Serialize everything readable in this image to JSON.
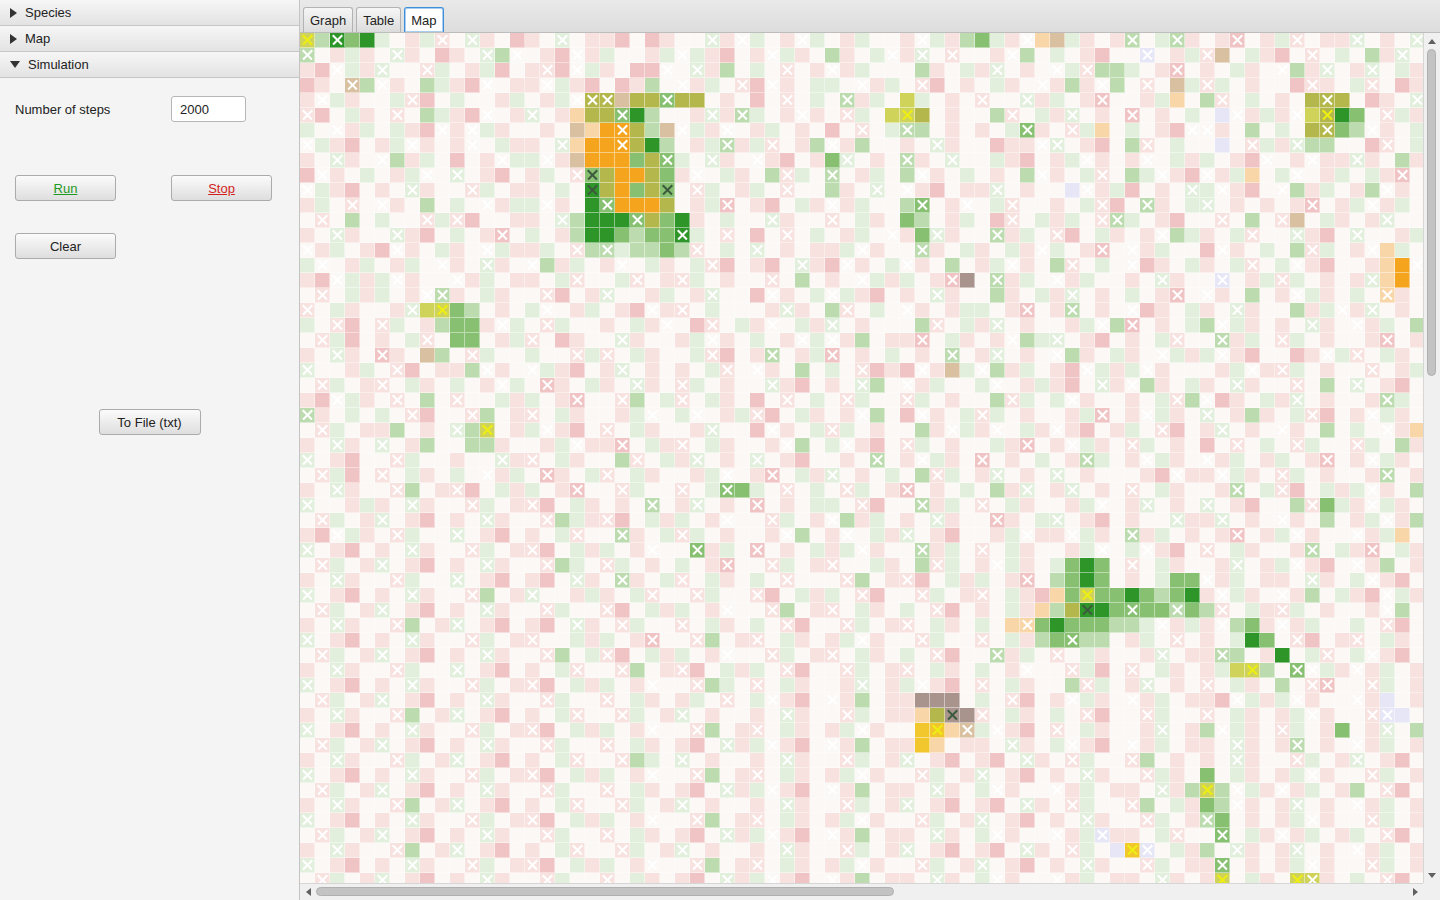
{
  "accordion": [
    {
      "label": "Species",
      "expanded": false
    },
    {
      "label": "Map",
      "expanded": false
    },
    {
      "label": "Simulation",
      "expanded": true
    }
  ],
  "simulation": {
    "steps_label": "Number of steps",
    "steps_value": "2000",
    "buttons": [
      {
        "label": "Run",
        "color": "#1e9a1e",
        "underline": true
      },
      {
        "label": "Stop",
        "color": "#d41f1f",
        "underline": true
      }
    ],
    "clear_label": "Clear",
    "export_label": "To File (txt)"
  },
  "tabs": [
    {
      "label": "Graph",
      "selected": false
    },
    {
      "label": "Table",
      "selected": false
    },
    {
      "label": "Map",
      "selected": true
    }
  ],
  "scrollbars": {
    "vertical": {
      "thumb_start": 0.0,
      "thumb_size": 0.4
    },
    "horizontal": {
      "thumb_start": 0.0,
      "thumb_size": 0.53
    }
  },
  "map": {
    "palette": {
      ".": "#fbf8f6",
      "p": "#f8e2e0",
      "r": "#f0c4c4",
      "g": "#e2efdc",
      "G": "#bcdcb0",
      "m": "#86c070",
      "d": "#2e9628",
      "o": "#f5a41e",
      "O": "#f9d6a8",
      "l": "#b4b84c",
      "y": "#cfd35a",
      "Y": "#f2c72e",
      "b": "#d8c0a0",
      "v": "#e6e6f6",
      "k": "#a8948c"
    },
    "mark_colors": {
      "w": "#ffffff",
      "y": "#eeee10",
      "d": "#3e5a3e"
    },
    "cells": [
      "yGdmd g.pgp .gp.r p.g.p pr.rp ..gp. g.p.g .pg.. p.gpG mgp.O bgp.p G.gGp .pr.p gp.pp g.p.g",
      "G.pgp .gp.r p.gG. .pr.p g..pg .gpr. p.gp. Gp.g. pg.p. .p.G. g.pr. .v.pg pb.gp r.p.g .Gpg.",
      "pr.gp g..pg .pgr. ppr.g p.rr. .gpG. g.p.p .pg.. .Gp.g pg.p. .gpGG g.pr. p.gp. .Gpg. pg.gp",
      "rp.bG .p.Gg pr..p p.gpr .rpG. .pg.p r.p.g g..pg .pr.p .gp.. pGp.G .p.bg pg.p. .rpp. gp.rp",
      "p.gp. .gpr. g..pg .pg.l lbllm ll.p. r.p.g .Gpg. yg.p. p..gp g.pr. .pgO. Gp.g. p.lll .rp.g",
      "pr.gp .p.Gg pr..p g.pOl lmdG. .pgpG g.p.p .pg.y yl.p. .Gp.g pg.p. r.p.g .v.pg p.yld m.pgp",
      "g..pg .gpr. p.gp. .p.bO oolGb .gp.. pg.p. r.p.g GG.p. p.gmp .pgO. g.pr. .p.G. g.llm G.p.g",
      ".gpr. pg.p. p..gp p.gOo ooldG .pgGp gp.pG .pG.. p.gp. .rpp. g.pr. Gp.g. .v.pg pgGG. .rp.g",
      "p.gp. .Gpg. r.p.g g.pbo oomlm g.gp. .pr.p mg.p. Gp.g. .gpr. pg.p. p..gp g.pr. .p.pp gp.Gp",
      "r.p.g .pg.. g.pr. pg.pm loolm p..gp .Gpg. G.pg. G.p.g .p.G. p.gp. Gg.pr .pgO. g..pg .gpr.",
      ".gpr. p.gp. .pg.p p.g.d lomlm .pg.p g.p.. Gp.g. .pr.p pg.p. .v.pg r.p.g g.pr. .Gpg. pG.p.",
      "pg.p. .p.G. g..pg g.p.d moool .pgr. pr.gp .pg.. Gm.p. .gp.. p.gpr .Gp.g g.p.p .pr.p g.pg.",
      ".p.G. g..pg pr..p p.gGd ddmlm dp.g. .gp.. p.gp. mG.pg .rp.g pg.pG g.pr. .p.G. pb.gp .pg..",
      "p.gp. .gpr. g.pr. g.pGd dmGmm dg.p. r.p.g .pg.. pmgp. .Gpg. pr.gp .p.Gg p.gp. .gpr. g..pg",
      ".pg.p r.p.g p..gp pg.pG GgGGm Gp.g. g.p.p pg.p. .Gp.g p.gp. g.pr. .pg.. r.p.g .Gpg. p.Og.",
      "g..pg .pg.. p.gp. .Gpg. p..gp .gpr. pr.gp r.p.g .p.G. pg.p. Gp.g. .rp.g p.gp. g.pr. .pOo.",
      "pr.gp g.p.. .pg.p p.gp. .gp.p pg.p. .p.G. p..gp g.prk .Gpg. .pg.. p.gp. .v.pg pg.p. pgOo.",
      ".p.gp g.p.G p.gp. .pr.p g..pg .pg.. r.p.g .gpr. p.gp. .Gp.g pg.p. g.pr. .p.G. p.gp. g.Op.",
      "p.gp. .pgyy mG.p. g..pg .pr.p p.g.. .pgp. Gp.g. .p.pg g.pr. pG.p. .rp.g p.gp. .Gpg. pg.p.",
      "g.pr. pg.pG mmp.g .pg.. p.gp. .rp.g p..gp g.p.. .Gp.g pg.p. .pg.G r.p.g G.gp. p.gp. .pg.G",
      ".pgr. p.gp. mm.pg p.rp. .gp.. pg.p. g.p.g .pG.p pr.gp .p.Gg g.pr. p.gp. .Gpg. pg.p. .pr.p",
      "p.gp. rp.bG .pg.. g..pg p.gp. .gpr. pG.pg r.p.g .p.G. pg.p. .Gp.g p..gp g.pr. .rp.g p.gp.",
      "g..pg .pr.p pG.p. .gpr. pg.p. p.gp. .p.G. g.prp r.pbg .Gpg. pr.gp g.p.. .pg.p pg.p. .p.pg",
      ".pg.p p.gp. g.p.g .rp.g p.gp. pg.p. .gpr. p.gG. .pg.. g..pg pr.gp .Gp.g p.gp. .p.G. g.pr.",
      "pr.gp .p.G. p..gp g.pr. .pG.g p.gp. r.p.g .pg.. pg.p. .Gpg. g.p.. p.gpG .rp.g pg.p. .pGg.",
      "Gp.g. g.pr. .pG.p p.gp. .pg.. g..pg pr.gp .p.G. r.p.g pg.p. .pgr. p.gp. g.pGp .gpr. p.gp.",
      ".pg.p pG.p. gGy.p g.pr. p.gp. .pg.. r.p.g pg.p. .Gp.g p..gp .pr.p g.pr. pg.p. .p.G. g..pO",
      "p.gp. g.pG. .GGp. .pg.p pr.gp p.gp. .p.G. g.pr. pg.p. .gpr. p.gp. pg.p. r.p.g .pg.. pg.Gp",
      "g.pr. .pg.. p..gp p.gp. .Gp.g pg.p. g.pr. .p.G. p.gp. r.p.g .pGg. p.gp. .pg.p g.pr. p.gp.",
      ".pgr. p.gp. g..pg .rp.g p.gp. .pg.. pr.gp g.p.g .Gpg. pg.p. g.p.. .pr.p p.gp. pg.p. .pG.p",
      "p.gp. .pG.p pr.gp g.pr. .pg.. p.gmm g.p.g .pg.p r.p.g .Gpg. pg.p. p.gp. .pG.g pr.gp g.p.G",
      "g..pg p.gp. .pg.p pr.gp .p.G. pg.p. r.p.g g.pr. .Gpg. p.gp. .pg.. pg.p. g.pr. .Gpmg p.gp.",
      ".pg.p g.pr. p.gp. .pGgp pr.gp g.p.. .pg.p .Gpg. p.gp. .rp.g g.pr. p..gp pg.p. .p.G. pg.pG",
      "pr.gp .pg.. g.pr. p.gp. .Gp.g pg.p. .p.G. p..gp g.pr. .pg.p p.gp. Gpg.p .pr.p g.p.. .pgO.",
      "g.pr. p.gp. .pg.p pr.gp g.p.. .mpg. r.p.g pg.p. .Gpg. p.gp. .pg.. g.pr. p.gp. .pG.g pr.gp",
      ".pg.p g.pr. p.gp. .pGg. pg.p. g.pr. .pg.p p..gp .Gpg. p.gp. gmdm. p.gp. .pg.p g.pr. .pG.p",
      "p.gp. .pg.. g.pr. pr.gp .Gp.g p.gp. g.p.. .pG.p pr.gp g.pr. Gmdm. p.gmm .pg.p p.gp. g.pr.",
      "g.pr. p.gp. .pG.p g..pg p.gp. .pg.. pr.gp g.pr. .pg.p p.gpr Omymm dmGmd p.gp. .pG.g pr.gp",
      ".pg.p g.pr. p.gp. .pg.. pr.gp g.p.. .pG.p p.gp. g.pr. p.gpO Glddm mmmGm Gp.gp pg.p. .p.G.",
      "p.gp. .pG.p g.pr. pr.gp .pg.. p.gp. g.pr. .pg.p p.gp. g.OOm dmmmG Gg.pg p.Gmp .pg.. g.pr.",
      "g.pr. p.gp. .pg.p p..gp g.pr. .pG.p p.gp. pg.p. .pg.. p.gpG mmGG. pg.p. p.gdm .pr.p p.gp.",
      ".pg.p g.pr. p.gp. .pG.g pr.gp g.p.. .pg.p p.gp. g.pr. .Gpg. p.gp. .pg.p pGG.p d.gp. g.pr.",
      "p.gp. .pg.. g.pr. p.gp. .pG.p pr.gp g.pr. .pg.p p.gp. g.p.. .pgr. p.gp. pgyyG .m.gp .pg.p",
      "g.pr. p.gp. .pg.p pr.gp g.p.. .pGg. p.gp. .pg.p g.pr. p.gp. .Gpg. pg.p. p.gp. G.pr. .pg.p",
      ".pg.p g.pr. p.gp. .pg.. p.gp. pg.p. g.pr. .pG.p pkkk. g.pr. p.gp. .pg.p pr.gp g.p.. .pv.p",
      "p.gp. .pG.p g.pr. p.gp. .pg.p g.p.. p.gp. .pg.p pOlkk p.gp. g.pr. .pg.. p.gp. pg.p. .pvv.",
      "g.pr. p.gp. .pg.p pr.gp g.p.. .pG.p p.gp. pg.p. .YYOb g.pr. p.gp. .pg.p G.gp. pg.pm .pg.G",
      ".pg.p g.pr. p.gp. .pg.. p.gp. pr.gp g.pr. .pG.p pYO.p p.gp. g.pr. .pg.p p.gp. pG.p. .pg.p",
      "p.gp. .pg.p g.pr. p.gp. .pGg. g.p.. p.gp. .pg.p g.pr. pr.gp .pg.. pG.p. p.gp. .pg.p g.pr.",
      "g.pr. p.gp. .pg.p pr.gp g.p.. .pG.p p.gp. pg.p. .pg.p g.pr. p.gp. .pgp. m.gp. pg.p. .pg.p",
      ".pg.p g.pr. p.gp. .pg.. p.gp. pr.gp g.pr. .pG.p p.gp. g.p.. .pg.p p.gpG yG.gp .pg.p G.pr.",
      "p.gp. .pG.p g.pr. p.gp. .pg.p g.p.. p.gp. .pg.p g.pr. pr.gp .pg.. pG.gp mG.p. pg.p. .pg.p",
      "g.pr. p.gp. .pg.p pr.gp g.p.. .pG.p p.gp. pg.p. .pg.p g.pr. p.gp. .pg.p Gm.p. pg.p. .pg.p",
      ".pg.p g.pr. p.gp. .pg.. p.gp. pr.gp g.pr. .pG.p p.gp. g.p.. .pgvp p.gp. .m.gp .pg.p g.pr.",
      "p.gp. .pG.p g.pr. p.gp. .pg.p g.p.. p.gp. .pg.p g.pr. pr.gp .pg.v Yv.gp G.gp. pg.p. .pg.p",
      "g.pr. p.gp. .pg.p pr.gp g.p.. .pG.p p.gp. pg.p. .pg.p g.pr. p.gp. .pg.p pm.p. pg.p. .pg.p",
      ".pg.p g.pr. p.gp. .pg.. p.gp. pr.gp g.pr. .pG.p p.gp. g.p.. .pg.p p.gp. py.gp .yyp. g.pr."
    ],
    "marks": [
      "y-w-- ----w -w--- --w-- ----- --w-w ---w- ----- -w--- ---w- ----- w--w- --w-- -w--- w---w",
      "w---- -w--- --w-w ---w- ----- w---- -w--- ----w -w-w- --w-- ----- -w--- w---- --w-- ---w-",
      "--w-- w--w- ----- -w-w- ----w -w--- --w-- w---- ----- -w--- w-w-- ---w- ----- w--w- -w---",
      "---w- w---- --w-- -w--- ----- w---w -w--- --w-- -w--- ----w ---w- -w--- w---- --w-- -w---",
      "-w--- --w-- ----- ---ww w---w ----- --w-- -w--- ----- w--w- ---w- ----- -w--- ---w- ----w",
      "w---- -w--- --w-- w---- -w--- --w-w ---w- -w--- y---- --w-- -w--- w---- --w-- -w-y- --w--",
      "--w-- ----w -w--- ----- -w--- w--w- ----- --w-- w---- ---w- -w--- ----w w---- ---w- -w---",
      "w---- --w-- -w--- --w-- -w--- ---w- -w--- w---- --w-- ----w w---- -w--- ---w- -w--- --w--",
      "--w-- w---- ---w- -w--- ----w --w-- w---- -w--- w--w- ----- --w-- -w--- ----w --w-- w----",
      "-w--- ---w- w---- ---wd ----- -w--- --w-- w---- -w--- ----w ---w- --w-- w---- -w--- ---w-",
      "w---- --w-- -w--- ----d ----d -w--- --w-- ---w- w---- -w--- --w-- ----w -w--- w---- --w--",
      "---w- w---- --w-- -w--- w---- ---w- ----- w---- -w--w --w-- ---w- -w--- w---- --w-- -w---",
      "-w--- ---w- w---- --w-- --w-- ----- -w--- w---- ----- --w-- ---ww ----- -w--- w---- --w--",
      "--w-- -w--- ---w- ----- ----- w--w- --w-- ----w --w-- -w--- w---- --w-- ---w- -w--- w----",
      "w---- -w--- --w-- ---w- w---- -w--- w---- --w-- -w--- ----w ---w- w---- -w--- --w-- -w---",
      "-w--- ----w --w-- w---- -w--- --w-- ---w- -w--- w---- --w-- -w--- w---- ---w- -w--- ----w",
      "--w-- -w--- w---- ---w- --w-- w---- -w--- --w-- ---w- -w--- w---- --w-- -w--- w---- -w---",
      "-w--- ---ww ----- -w--- w---- --w-- -w--- w---- --w-- ----- -w--- ---w- w---- -w--- --w--",
      "w---- --w-y ----- -w--- ---w- w---- --w-- -w--- w---- ---w- -w--- w---- --w-- ----w -w---",
      "--w-- w---- ---w- -w--- ----w --w-- -w--- w---- --w-- -w--- ---w- w---- -w--- --w-- w----",
      "-w--- ---w- ----- w---- -w--- --w-- ---w- w---- -w--- --w-- w---- ---w- -w--- w---- --w--",
      "--w-- w---- -w--- ---w- w---- --w-- -w--- w---- ---w- -w--- w---- --w-- -w--- ---w- w----",
      "w---- -w--- --w-- w---- -w--- ---w- w---- --w-- -w--- w---- --w-- -w--- ---w- w---- -w---",
      "-w--- w---- ---w- -w--- --w-- w---- -w--- --w-- w---- -w--- ---w- w---- --w-- -w--- w----",
      "--w-- -w--- w---- ---w- -w--- w---- --w-- -w--- w---- --w-- -w--- ---w- w---- -w--- --w--",
      "w---- --w-- -w--- w---- ---w- -w--- w---- --w-- -w--- w---- ---w- -w--- w---- --w-- -w---",
      "-w--- ----- w-y-- -w--- w---- --w-- -w--- w---- ---w- -w--- w---- --w-- -w--- w---- --w--",
      "--w-- w---- ----- ---w- -w--- w---- --w-- -w--- w---- ---w- -w--- w---- --w-- -w--- w----",
      "w---- -w--- ---w- w---- --w-- -w--- w---- ---w- -w--- w---- --w-- -w--- w---- ---w- -w---",
      "-w--- w---- --w-- -w--- w---- ---w- -w--- w---- --w-- -w--- w---- ---w- -w--- w---- --w--",
      "--w-- -w--- w---- ---w- -w--- w--w- --w-- -w--- w---- ---w- -w--- w---- --w-- w---- -w---",
      "w---- --w-- -w--- w---- ---w- -w--- w---- --w-- -w--- w---- ---w- -w--- w---- --w-- -w---",
      "-w--- w---- --w-- -w--- w---- ---w- -w--- w---- --w-- -w--- w---- ---w- -w--- w---- --w--",
      "--w-- -w--- w---- ---w- -w--- w---- --w-- -w--- w---- ---w- -w--- w---- --w-- -w--- w----",
      "w---- --w-- -w--- w---- ---w- -w--- w---- --w-- -w--- w---- ---w- -w--- w---- --w-- -w---",
      "-w--- w---- --w-- -w--- w---- ---w- -w--- w---- --w-- -w--- ----- w---- --w-- -w--- w----",
      "--w-- -w--- w---- ---w- -w--- w---- --w-- -w--- w---- ---w- ----- ----- w---- --w-- -w---",
      "w---- --w-- -w--- w---- ---w- -w--- w---- --w-- -w--- w---- --y-- ----- -w--- w---- --w--",
      "-w--- w---- --w-- -w--- w---- ---w- -w--- w---- --w-- ----- --d-- w--w- -w--- w---- --w--",
      "--w-- -w--- w---- ---w- -w--- w---- --w-- -w--- w---- ---w- ----- --w-- -w--- w---- --w--",
      "w---- --w-- -w--- w---- ---w- -w--- w---- --w-- -w--- w---- -w--- ---w- ----- -w--- w----",
      "-w--- w---- --w-- -w--- w---- ---w- -w--- w---- --w-- -w--- w---- --w-- -w--- ---w- -w---",
      "--w-- -w--- w---- ---w- -w--- w---- --w-- -w--- w---- ---w- -w--- w---- ---y- -ww-- w----",
      "w---- --w-- -w--- w---- ---w- -w--- w---- --w-- -w--- w---- --w-- -w--- w---- --ww- -w---",
      "-w--- w---- --w-- -w--- w---- ---w- -w--- w---- ----- --w-- -w--- w---- --w-- -w--- w----",
      "--w-- -w--- w---- ---w- -w--- w---- --w-- -w--- ---d- w---- --w-- -w--- w---- --w-- -ww--",
      "w---- --w-- -w--- w---- ---w- -w--- w---- --w-- --y-w -w--- w---- --w-- -w--- w---- --w--",
      "-w--- w---- --w-- -w--- w---- ---w- -w--- w---- ----- --w-- -w--- w---- --w-- -w--- w----",
      "--w-- -w--- w---- ---w- -w--- w---- --w-- -w--- w---- ---w- -w--- w---- --w-- -w--- w----",
      "w---- --w-- -w--- w---- ---w- -w--- w---- --w-- -w--- w---- --w-- -w--- ----- --w-- -w---",
      "-w--- w---- --w-- -w--- w---- ---w- -w--- w---- --w-- -w--- w---- --w-- y-w-- w---- --w--",
      "--w-- -w--- w---- ---w- -w--- w---- --w-- -w--- w---- ---w- -w--- w---- --w-- -w--- w----",
      "w---- --w-- -w--- w---- ---w- -w--- w---- --w-- -w--- w---- --w-- -w--- w---- --w-- -w---",
      "-w--- w---- --w-- -w--- w---- ---w- -w--- w---- --w-- -w--- w--w- ---w- -w--- w---- --w--",
      "--w-- -w--- w---- ---w- -w--- w---- --w-- -w--- w---- ---w- -w--- yw--- --w-- -w--- w----",
      "w---- --w-- -w--- w---- ---w- -w--- w---- --w-- -w--- w---- --w-- -w--- -w--- --w-- -w---",
      "-w--- w---- --w-- -w--- w---- ---w- -w--- w---- --w-- -w--- w---- --w-- -y--- -yw-- --w--"
    ]
  }
}
